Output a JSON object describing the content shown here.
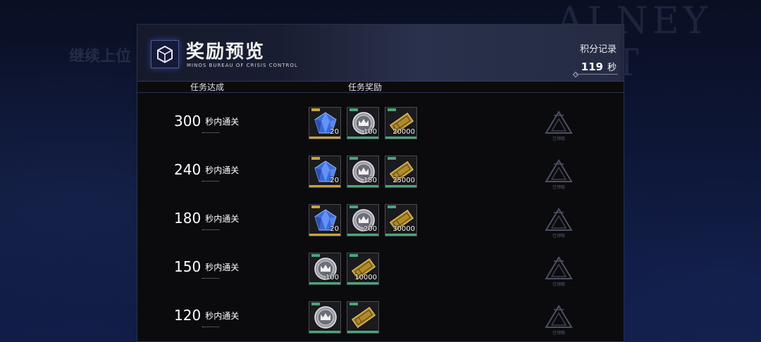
{
  "background": {
    "left_text": "继续上位",
    "right_logo": "ALNEY SYT"
  },
  "header": {
    "logo_icon": "cube-icon",
    "title": "奖励预览",
    "subtitle": "MINOS BUREAU OF CRISIS CONTROL",
    "score_label": "积分记录",
    "score_value": "119",
    "score_unit": "秒"
  },
  "columns": {
    "condition": "任务达成",
    "reward": "任务奖励"
  },
  "rows": [
    {
      "time": "300",
      "suffix": "秒内通关",
      "rewards": [
        {
          "type": "crystal",
          "qty": "20"
        },
        {
          "type": "coin",
          "qty": "100"
        },
        {
          "type": "ticket",
          "qty": "20000"
        }
      ],
      "status": "已领取"
    },
    {
      "time": "240",
      "suffix": "秒内通关",
      "rewards": [
        {
          "type": "crystal",
          "qty": "20"
        },
        {
          "type": "coin",
          "qty": "150"
        },
        {
          "type": "ticket",
          "qty": "25000"
        }
      ],
      "status": "已领取"
    },
    {
      "time": "180",
      "suffix": "秒内通关",
      "rewards": [
        {
          "type": "crystal",
          "qty": "20"
        },
        {
          "type": "coin",
          "qty": "200"
        },
        {
          "type": "ticket",
          "qty": "30000"
        }
      ],
      "status": "已领取"
    },
    {
      "time": "150",
      "suffix": "秒内通关",
      "rewards": [
        {
          "type": "coin",
          "qty": "100"
        },
        {
          "type": "ticket",
          "qty": "10000"
        }
      ],
      "status": "已领取"
    },
    {
      "time": "120",
      "suffix": "秒内通关",
      "rewards": [
        {
          "type": "coin",
          "qty": ""
        },
        {
          "type": "ticket",
          "qty": ""
        }
      ],
      "status": "已领取"
    }
  ],
  "colors": {
    "accent_gold": "#c9a53a",
    "accent_green": "#4aa67a",
    "panel_bg": "#0b0b0e"
  }
}
